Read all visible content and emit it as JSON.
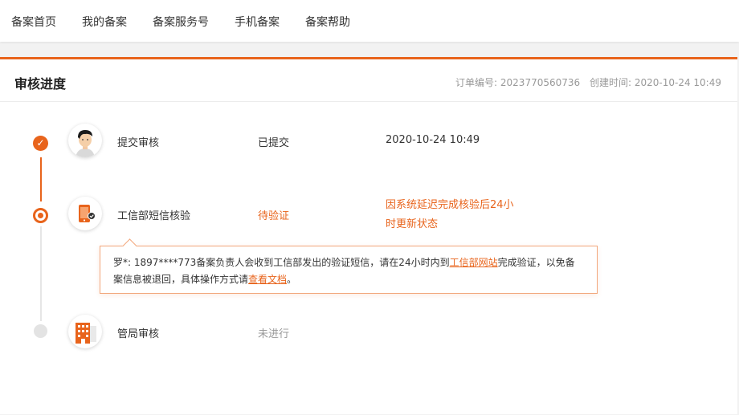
{
  "nav": {
    "items": [
      "备案首页",
      "我的备案",
      "备案服务号",
      "手机备案",
      "备案帮助"
    ]
  },
  "header": {
    "title": "审核进度",
    "order_label": "订单编号: 2023770560736",
    "created_label": "创建时间: 2020-10-24 10:49"
  },
  "steps": [
    {
      "name": "提交审核",
      "status": "已提交",
      "time": "2020-10-24 10:49",
      "icon": "person-avatar-icon",
      "state": "done"
    },
    {
      "name": "工信部短信核验",
      "status": "待验证",
      "note": "因系统延迟完成核验后24小时更新状态",
      "icon": "phone-verify-icon",
      "state": "active"
    },
    {
      "name": "管局审核",
      "status": "未进行",
      "icon": "building-icon",
      "state": "todo"
    }
  ],
  "tooltip": {
    "text_1": "罗*: 1897****773备案负责人会收到工信部发出的验证短信，请在24小时内到",
    "link_1": "工信部网站",
    "text_2": "完成验证，以免备案信息被退回，具体操作方式请",
    "link_2": "查看文档",
    "text_3": "。"
  },
  "colors": {
    "accent": "#e8641c",
    "pending_gray": "#999999"
  }
}
